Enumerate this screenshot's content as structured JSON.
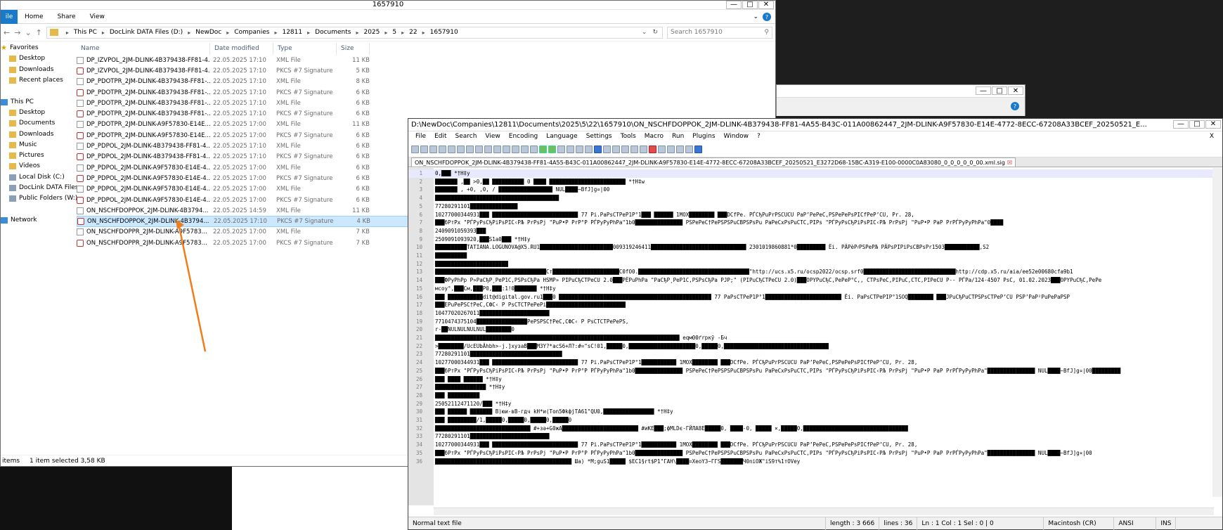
{
  "explorer": {
    "title": "1657910",
    "ribbon_tabs": [
      "ile",
      "Home",
      "Share",
      "View"
    ],
    "breadcrumb": [
      "This PC",
      "DocLink DATA Files (D:)",
      "NewDoc",
      "Companies",
      "12811",
      "Documents",
      "2025",
      "5",
      "22",
      "1657910"
    ],
    "search_placeholder": "Search 1657910",
    "columns": [
      "Name",
      "Date modified",
      "Type",
      "Size"
    ],
    "sidebar": [
      {
        "label": "Favorites",
        "icon": "star-icon"
      },
      {
        "label": "Desktop",
        "icon": "desktop-icon"
      },
      {
        "label": "Downloads",
        "icon": "downloads-icon"
      },
      {
        "label": "Recent places",
        "icon": "recent-places-icon"
      },
      {
        "label": "",
        "icon": ""
      },
      {
        "label": "This PC",
        "icon": "computer-icon"
      },
      {
        "label": "Desktop",
        "icon": "desktop-icon"
      },
      {
        "label": "Documents",
        "icon": "documents-icon"
      },
      {
        "label": "Downloads",
        "icon": "downloads-icon"
      },
      {
        "label": "Music",
        "icon": "music-icon"
      },
      {
        "label": "Pictures",
        "icon": "pictures-icon"
      },
      {
        "label": "Videos",
        "icon": "videos-icon"
      },
      {
        "label": "Local Disk (C:)",
        "icon": "drive-icon"
      },
      {
        "label": "DocLink DATA Files",
        "icon": "drive-icon"
      },
      {
        "label": "Public Folders (W:)",
        "icon": "network-drive-icon"
      },
      {
        "label": "",
        "icon": ""
      },
      {
        "label": "Network",
        "icon": "network-icon"
      }
    ],
    "files": [
      {
        "name": "DP_IZVPOL_2JM-DLINK-4B379438-FF81-4...",
        "date": "22.05.2025 17:10",
        "type": "XML File",
        "size": "11 KB",
        "kind": "xml"
      },
      {
        "name": "DP_IZVPOL_2JM-DLINK-4B379438-FF81-4...",
        "date": "22.05.2025 17:10",
        "type": "PKCS #7 Signature",
        "size": "5 KB",
        "kind": "sig"
      },
      {
        "name": "DP_PDOTPR_2JM-DLINK-4B379438-FF81-...",
        "date": "22.05.2025 17:10",
        "type": "XML File",
        "size": "8 KB",
        "kind": "xml"
      },
      {
        "name": "DP_PDOTPR_2JM-DLINK-4B379438-FF81-...",
        "date": "22.05.2025 17:10",
        "type": "PKCS #7 Signature",
        "size": "6 KB",
        "kind": "sig"
      },
      {
        "name": "DP_PDOTPR_2JM-DLINK-4B379438-FF81-...",
        "date": "22.05.2025 17:10",
        "type": "XML File",
        "size": "6 KB",
        "kind": "xml"
      },
      {
        "name": "DP_PDOTPR_2JM-DLINK-4B379438-FF81-...",
        "date": "22.05.2025 17:10",
        "type": "PKCS #7 Signature",
        "size": "6 KB",
        "kind": "sig"
      },
      {
        "name": "DP_PDOTPR_2JM-DLINK-A9F57830-E14E...",
        "date": "22.05.2025 17:00",
        "type": "XML File",
        "size": "11 KB",
        "kind": "xml"
      },
      {
        "name": "DP_PDOTPR_2JM-DLINK-A9F57830-E14E...",
        "date": "22.05.2025 17:00",
        "type": "PKCS #7 Signature",
        "size": "6 KB",
        "kind": "sig"
      },
      {
        "name": "DP_PDPOL_2JM-DLINK-4B379438-FF81-4...",
        "date": "22.05.2025 17:10",
        "type": "XML File",
        "size": "6 KB",
        "kind": "xml"
      },
      {
        "name": "DP_PDPOL_2JM-DLINK-4B379438-FF81-4...",
        "date": "22.05.2025 17:10",
        "type": "PKCS #7 Signature",
        "size": "6 KB",
        "kind": "sig"
      },
      {
        "name": "DP_PDPOL_2JM-DLINK-A9F57830-E14E-4...",
        "date": "22.05.2025 17:00",
        "type": "XML File",
        "size": "6 KB",
        "kind": "xml"
      },
      {
        "name": "DP_PDPOL_2JM-DLINK-A9F57830-E14E-4...",
        "date": "22.05.2025 17:00",
        "type": "PKCS #7 Signature",
        "size": "6 KB",
        "kind": "sig"
      },
      {
        "name": "DP_PDPOL_2JM-DLINK-A9F57830-E14E-4...",
        "date": "22.05.2025 17:00",
        "type": "XML File",
        "size": "6 KB",
        "kind": "xml"
      },
      {
        "name": "DP_PDPOL_2JM-DLINK-A9F57830-E14E-4...",
        "date": "22.05.2025 17:00",
        "type": "PKCS #7 Signature",
        "size": "6 KB",
        "kind": "sig"
      },
      {
        "name": "ON_NSCHFDOPPOK_2JM-DLINK-4B3794...",
        "date": "22.05.2025 14:59",
        "type": "XML File",
        "size": "11 KB",
        "kind": "xml"
      },
      {
        "name": "ON_NSCHFDOPPOK_2JM-DLINK-4B3794...",
        "date": "22.05.2025 17:10",
        "type": "PKCS #7 Signature",
        "size": "4 KB",
        "kind": "sig",
        "selected": true
      },
      {
        "name": "ON_NSCHFDOPPR_2JM-DLINK-A9F5783...",
        "date": "22.05.2025 17:00",
        "type": "XML File",
        "size": "7 KB",
        "kind": "xml"
      },
      {
        "name": "ON_NSCHFDOPPR_2JM-DLINK-A9F5783...",
        "date": "22.05.2025 17:00",
        "type": "PKCS #7 Signature",
        "size": "7 KB",
        "kind": "sig"
      }
    ],
    "status": {
      "items": "items",
      "selected": "1 item selected  3,58 KB"
    }
  },
  "npp": {
    "title": "D:\\NewDoc\\Companies\\12811\\Documents\\2025\\5\\22\\1657910\\ON_NSCHFDOPPOK_2JM-DLINK-4B379438-FF81-4A55-B43C-011A00862447_2JM-DLINK-A9F57830-E14E-4772-8ECC-67208A33BCEF_20250521_E...",
    "menus": [
      "File",
      "Edit",
      "Search",
      "View",
      "Encoding",
      "Language",
      "Settings",
      "Tools",
      "Macro",
      "Run",
      "Plugins",
      "Window",
      "?"
    ],
    "tab": "ON_NSCHFDOPPOK_2JM-DLINK-4B379438-FF81-4A55-B43C-011A00862447_2JM-DLINK-A9F57830-E14E-4772-8ECC-67208A33BCEF_20250521_E3272D68-15BC-A319-E100-0000C0A83080_0_0_0_0_0_00.xml.sig",
    "lines": [
      "0,███  *†H‡y",
      "███████ ,██ >0,██ ██████████ 0  ████ ████████████████████████  *†H‡w",
      "███████ ,  +0, ,0, / █████████████████ NUL████~BfJ]g¤|00",
      "███████████████████████████████████████",
      "77280291101███████████████",
      "10277000344931███  ███████████████████████████ 77 Pi.PaPsCTPeP1P°1███ ██████ 1MOX████████  ███DCfPe. PЃCђPuPrPSCUCU PaP’PePeC,PSPePePsPICfPeP’CU, Pr. 28,",
      "███бPтPх \"PЃPуPsCђPiPsPIC‹PЉ PrPsPј \"PuP•P PrP°P PЃPуPуPhPa\"1b0███████████████ PSPePeC†PePSPSPuCBPSPsPu PaPeCхPsPuCTC,PIPs \"PЃPуPsCђPiPsPIC‹PЉ PrPsPј \"PuP•P PaP PrPЃPуPуPhPa\"0████",
      "2409091059393███",
      "2509091093920,███S1a0███  *†H‡y",
      "██████████TATIANA.LOGUNOVA@X5.RU1███████████████████████009319246411██████████████████████████████ 2301019860881*0█████████ Ёi. PÄPèP҂PSPePЉ PÄPsPIPiPsCBPsPr1503███████████,S2",
      "██████████",
      "███████████████████████",
      "███████████████████████████████████Cт█████████████████████C0fO0.███████████████████████████████████\"http://ucs.x5.ru/ocsp2022/ocsp.srf0█████████████████████████████http://cdp.x5.ru/aia/ee52e00680cfa9b1",
      "███ФPуPhPр P»PaCђP¸PeP1C,PSPsCђPa HSMP» PIPuCђCTPeCU 2.0███PЁPuPhPa \"PaCђP¸PeP1C,PSPsCђPa PJP;\" (PIPuCђCTPeCU 2.0)███OPYPuCђC,PePeP°C‚, CTPsPeC,PIPuC,CTC,PIPeCU P-- PЃPа/124-4507 PsC, 01.02.2023███OPYPuCђC,PePe",
      "мсоy°,███Cм,███P0,███:1!0███████ *†H‡y",
      "███ ███████████dit@digital.gov.ru1███0   ████████████████████████████████████████████████ 77 PaPsCTPeP1P°1████████████████████████ Ёi. PaPsCTPePIP°1SOQ████████  ███JPuCђPuCTPSPsCTPeP’CU PSP’PaP²PuPePaPSP",
      "███ЕPuPePЅC†PeC,CФC‹ P PsCTCTPePePi█████████████████████████",
      "10477020267011██████████████████████",
      "7710474375104████████████████PePSPЅC†PeC,CФC‹ P PsCTCTPePePЅ,",
      "r-██NULNULNULNUL████████0",
      "█████████████████████████████████████████████████████████████████████████████ еqм00ґrpкӯ -Бч",
      ">████████/UcEUbÄhbh>-ј.]хузаВ███M3Y?*acS6+Л?:#=\"sC!01,█████0,█████████████████████0,█████0,█████████████████████████████████",
      "77280291101█████████████████████████████",
      "10277000344931███  ███████████████████████████ 77 Pi.PaPsCTPeP1P°1███████████ 1MOX████████  ███DCfPe. PЃCђPuPrPSCUCU PaP’PePeC,PSPePePsPICfPeP’CU, Pr. 28,",
      "███бPтPх \"PЃPуPsCђPiPsPIC‹PЉ PrPsPј \"PuP•P PrP°P PЃPуPуPhPa\"1b0███████████████ PSPePeC†PePSPSPuCBPSPsPu PaPeCхPsPuCTC,PIPs \"PЃPуPsCђPiPsPIC‹PЉ PrPsPј \"PuP•P PaP PrPЃPуPуPhPa\"███████████████ NUL████~BfJ]g¤|00█████████",
      "███ ████ ██████  *†H‡y",
      "████████████████  *†H‡y",
      "███ ██████████",
      "25052112471120/███  *†H‡y",
      "███ ██████ ███████ B)юи-вB-гдч kH*и(Ton5ФkфjTA61\"QU0,████████████████ *†H‡y",
      "███ █████████/1,█████0,█████0,█████0,█████0",
      "██████████████████████████████ #+зә+G0жA████████████████████████ #иKE███;фMLDє-ГЙЛA8Е█████0, ████-0, █████ ×,█████0,█████████████████████████████████",
      "77280291101█████████████████████████",
      "10277000344931███  ███████████████████████████ 77 Pi.PaPsCTPeP1P°1███████████ 1MOX████████  ███DCfPe. PЃCђPuPrPSCUCU PaP’PePeC,PSPePePsPICfPeP’CU, Pr. 28,",
      "███бPтPх \"PЃPуPsCђPiPsPIC‹PЉ PrPsPј \"PuP•P PrP°P PЃPуPуPhPa\"1b0███████████████ PSPePeC†PePSPSPuCBPSPsPu PaPeCхPsPuCTC,PIPs \"PЃPуPsCђPiPsPIC‹PЉ PrPsPј \"PuP•P PaP PrPЃPуPуPhPa\"███████████████ NUL████~BfJ]g¤|00",
      "███████████████████████████████████████████ Ша) *М;guS1█████ $EC1§rt$P1\"ГАН\\████=XeoY3~ГГS███████Ч0niОЖ\"iS9т%1тОVey"
    ],
    "status": {
      "type": "Normal text file",
      "length": "length : 3 666",
      "lines": "lines : 36",
      "pos": "Ln : 1    Col : 1    Sel : 0 | 0",
      "eol": "Macintosh (CR)",
      "enc": "ANSI",
      "ins": "INS"
    }
  },
  "colors": {
    "accent": "#1979ca",
    "selection": "#cce8ff",
    "arrow": "#f07d1a"
  }
}
